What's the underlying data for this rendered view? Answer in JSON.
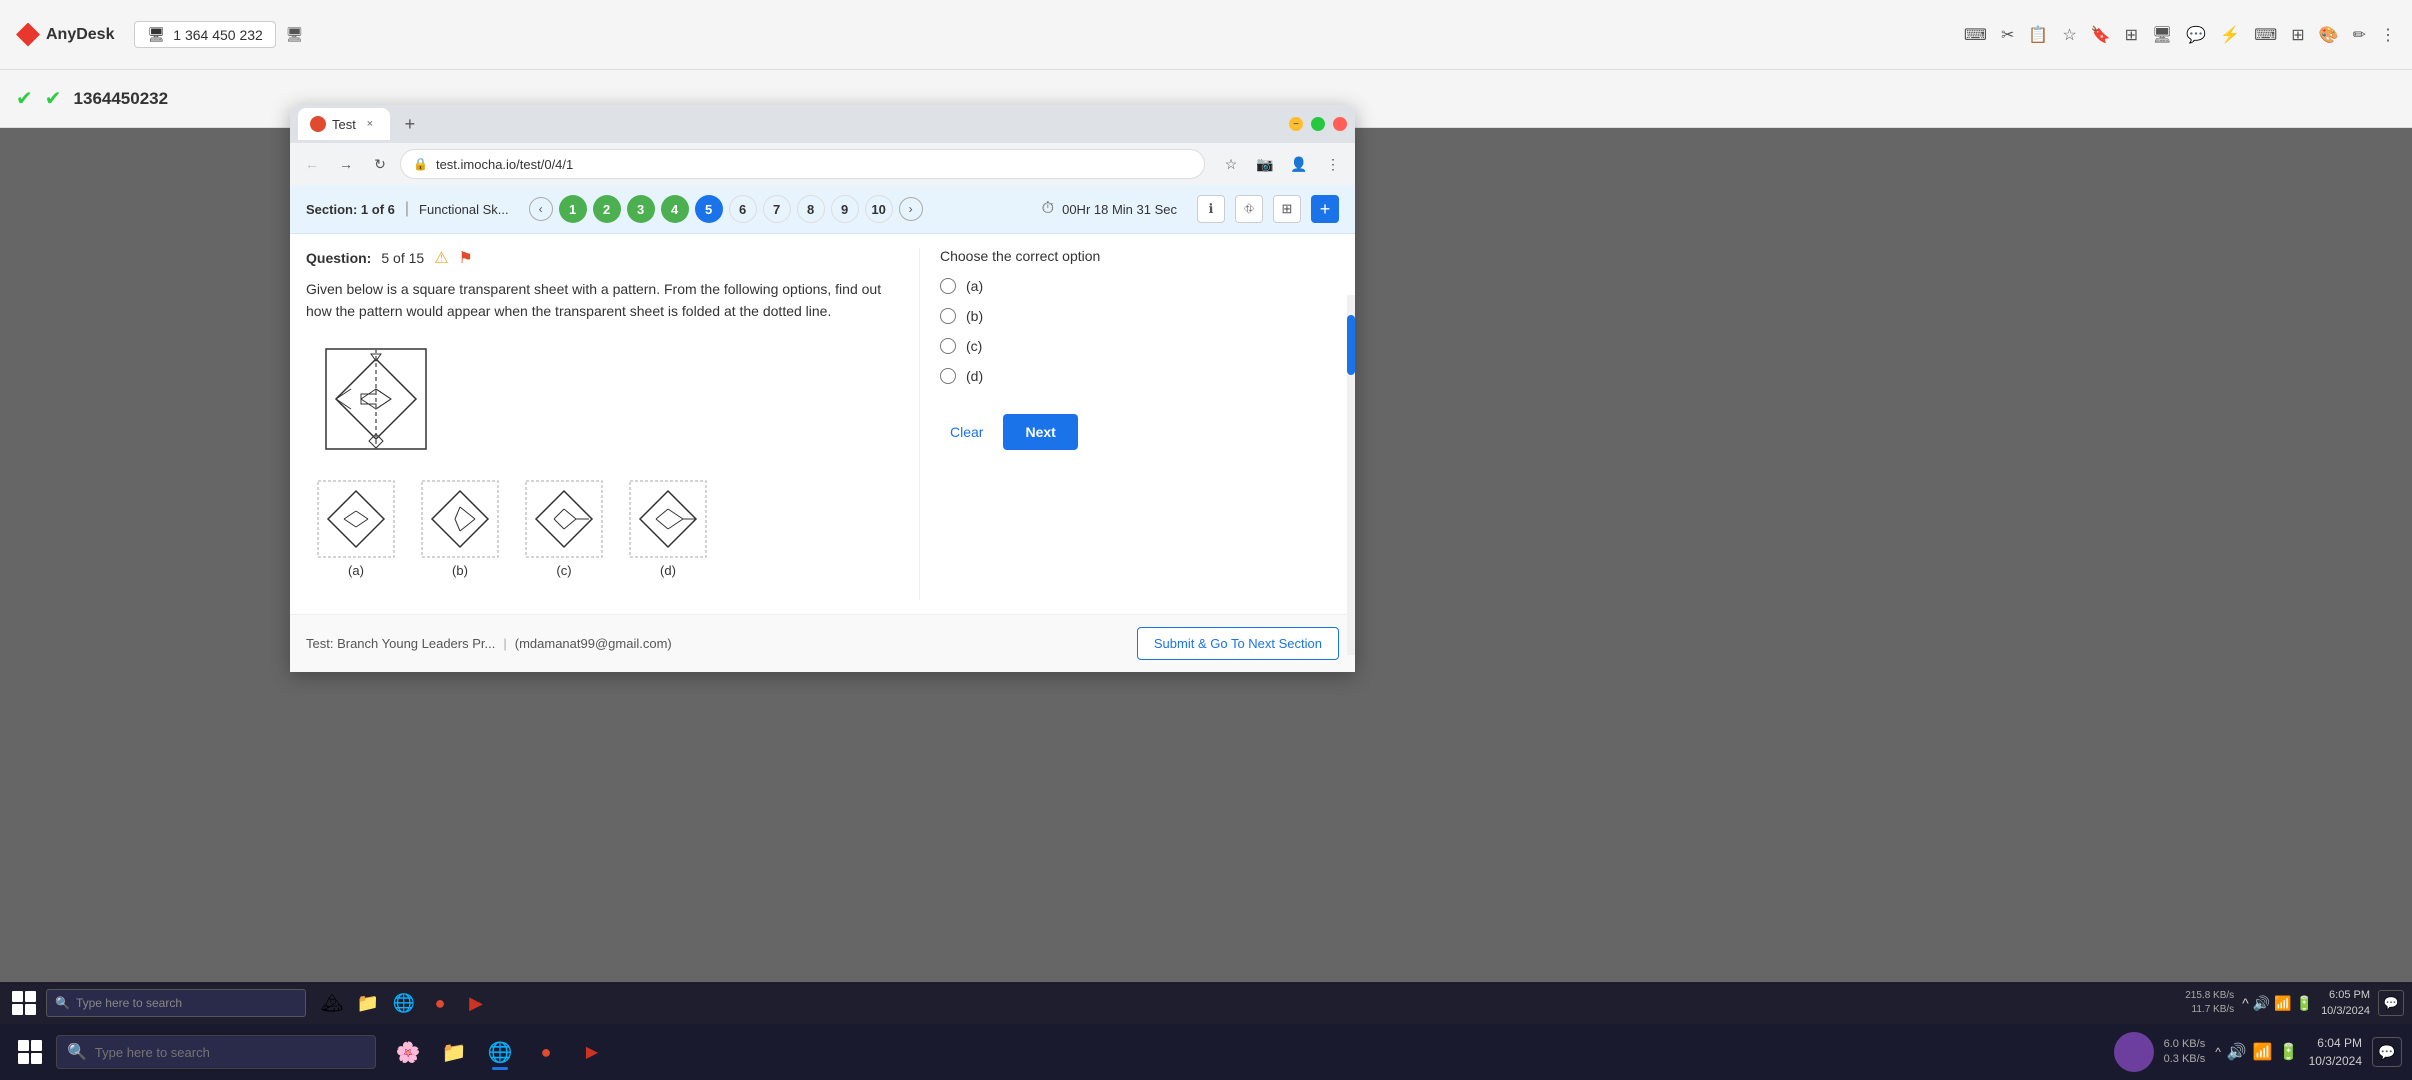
{
  "anydesk": {
    "app_name": "AnyDesk",
    "connection_id": "1 364 450 232",
    "remote_id": "1364450232"
  },
  "browser": {
    "tab_title": "Test",
    "url": "test.imocha.io/test/0/4/1",
    "favicon": "🔴"
  },
  "section": {
    "label": "Section:",
    "current": "1",
    "total": "6",
    "divider": "|",
    "name": "Functional Sk...",
    "timer_label": "00Hr 18 Min 31 Sec"
  },
  "question": {
    "label": "Question:",
    "number": "5",
    "total": "15",
    "text": "Given below is a square transparent sheet with a pattern. From the following options, find out how the pattern would appear when the transparent sheet is folded at the dotted line."
  },
  "question_nav": {
    "numbers": [
      1,
      2,
      3,
      4,
      5,
      6,
      7,
      8,
      9,
      10
    ],
    "states": [
      "answered",
      "answered",
      "answered",
      "answered",
      "current",
      "default",
      "default",
      "default",
      "default",
      "default"
    ]
  },
  "answer_panel": {
    "instruction": "Choose the correct option",
    "options": [
      {
        "id": "a",
        "label": "(a)"
      },
      {
        "id": "b",
        "label": "(b)"
      },
      {
        "id": "c",
        "label": "(c)"
      },
      {
        "id": "d",
        "label": "(d)"
      }
    ],
    "clear_label": "Clear",
    "next_label": "Next"
  },
  "footer": {
    "test_label": "Test: Branch Young Leaders Pr...",
    "divider": "|",
    "email": "(mdamanat99@gmail.com)",
    "submit_label": "Submit & Go To Next Section"
  },
  "taskbar": {
    "search_placeholder": "Type here to search",
    "clock_time": "6:04 PM",
    "clock_date": "10/3/2024",
    "net_down": "6.0 KB/s",
    "net_up": "0.3 KB/s"
  },
  "inner_taskbar": {
    "search_placeholder": "Type here to search",
    "clock_time": "6:05 PM",
    "clock_date": "10/3/2024",
    "net_down": "215.8 KB/s",
    "net_up": "11.7 KB/s"
  },
  "figure_labels": {
    "a": "(a)",
    "b": "(b)",
    "c": "(c)",
    "d": "(d)"
  }
}
